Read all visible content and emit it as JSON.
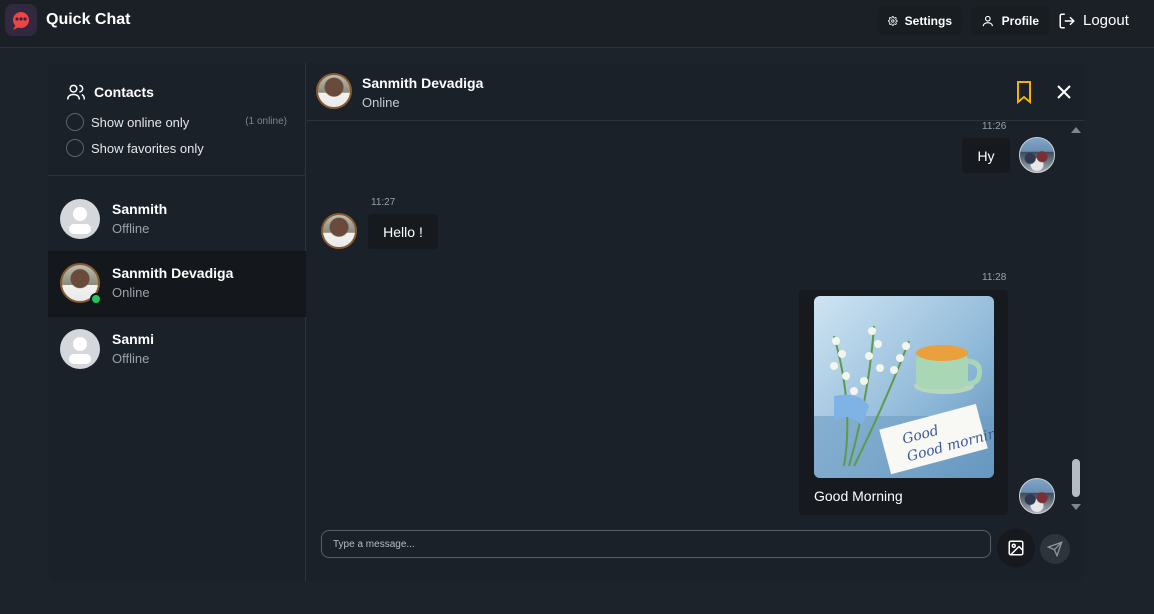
{
  "app": {
    "title": "Quick Chat",
    "logo_icon": "chat-logo-icon",
    "accent": "#ef4444"
  },
  "nav": {
    "settings": "Settings",
    "profile": "Profile",
    "logout": "Logout"
  },
  "sidebar": {
    "heading": "Contacts",
    "filters": [
      {
        "label": "Show online only",
        "checked": false
      },
      {
        "label": "Show favorites only",
        "checked": false
      }
    ],
    "online_count": "(1 online)",
    "contacts": [
      {
        "name": "Sanmith",
        "status": "Offline",
        "avatar": "default-avatar",
        "active": false
      },
      {
        "name": "Sanmith Devadiga",
        "status": "Online",
        "avatar": "photo-avatar",
        "active": true
      },
      {
        "name": "Sanmi",
        "status": "Offline",
        "avatar": "default-avatar",
        "active": false
      }
    ]
  },
  "chat": {
    "name": "Sanmith Devadiga",
    "status": "Online",
    "bookmark_color": "#f5b301",
    "messages": [
      {
        "time": "11:26",
        "text": "Hy",
        "direction": "outgoing"
      },
      {
        "time": "11:27",
        "text": "Hello !",
        "direction": "incoming"
      },
      {
        "time": "11:28",
        "text": "Good Morning",
        "direction": "outgoing",
        "image_alt": "Good morning."
      }
    ]
  },
  "composer": {
    "placeholder": "Type a message..."
  },
  "colors": {
    "background": "#1d232a",
    "panel": "#1b2128",
    "online": "#22c55e"
  }
}
